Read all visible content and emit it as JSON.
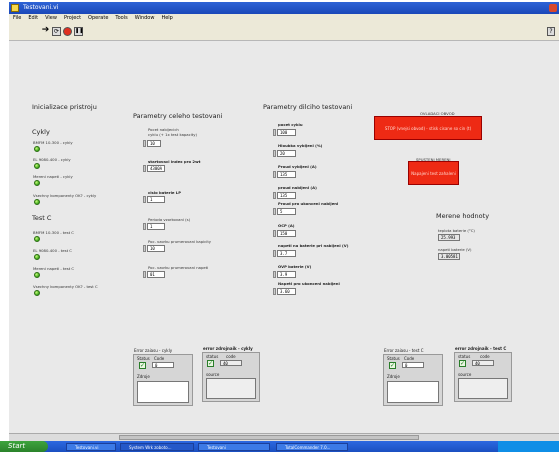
{
  "window": {
    "title": "Testovani.vi"
  },
  "menu": [
    "File",
    "Edit",
    "View",
    "Project",
    "Operate",
    "Tools",
    "Window",
    "Help"
  ],
  "init": {
    "heading": "Inicializace pristroju",
    "cycles_heading": "Cykly",
    "cycle_items": [
      "BMFM 10-300 - cykly",
      "EL 9080-400 - cykly",
      "Mereni napeti - cykly",
      "Vsechny komponenty OK? - cykly"
    ],
    "test_heading": "Test C",
    "test_items": [
      "BMFM 10-300 - test C",
      "EL 9080-400 - test C",
      "Mereni napeti - test C",
      "Vsechny komponenty OK? - test C"
    ]
  },
  "global": {
    "heading": "Parametry celeho testovani",
    "fields": [
      {
        "label": "Pocet nabijecich\ncyklu (+ 1x test kapacity)",
        "value": "10"
      },
      {
        "label": "startovaci index pro 2wt",
        "value": "4300A"
      },
      {
        "label": "cislo baterie LP",
        "value": "1"
      },
      {
        "label": "Perioda vzorkovani (s)",
        "value": "1"
      },
      {
        "label": "Poc. vzorku prumerovani kapicity",
        "value": "10"
      },
      {
        "label": "Poc. vzorku prumerovani napeti",
        "value": "01"
      }
    ]
  },
  "partial": {
    "heading": "Parametry dilciho testovani",
    "fields": [
      {
        "label": "pocet cyklu",
        "value": "100"
      },
      {
        "label": "Hloubka vybijeni  (%)",
        "value": "20"
      },
      {
        "label": "Proud vybijeni (A)",
        "value": "135"
      },
      {
        "label": "proud nabijeni (A)",
        "value": "135"
      },
      {
        "label": "Proud pro ukonceni nabijeni",
        "value": "5"
      },
      {
        "label": "OCP (A)",
        "value": "150"
      },
      {
        "label": "napeti na baterie pri nabijeni (V)",
        "value": "3.7"
      },
      {
        "label": "OVP baterie (V)",
        "value": "3.9"
      },
      {
        "label": "Napeti pro ukonceni nabijeni",
        "value": "3.60"
      }
    ]
  },
  "control": {
    "ovladaci_label": "OVLADACI OBVOD",
    "stop_text": "STOP (vnejsi obvod) - stisk cisane so cin (t)",
    "spusteni_label": "SPUSTENI MERENI",
    "start_text": "Napajeni test zahaleni"
  },
  "measured": {
    "heading": "Merene hodnoty",
    "temp_label": "teplota baterie (°C)",
    "temp_value": "25.993",
    "volt_label": "napeti baterie (V)",
    "volt_value": "3.00581"
  },
  "clusters": {
    "left_err_in": {
      "title": "Error zaiasu - cykly",
      "status": "Status",
      "code": "Code",
      "code_val": "0",
      "source": "Zdroje"
    },
    "left_err_out": {
      "title": "error zdrojnaik - cykly",
      "status": "status",
      "code": "code",
      "code_val": "40",
      "source": "source"
    },
    "right_err_in": {
      "title": "Error zaiasu - test C",
      "status": "Status",
      "code": "Code",
      "code_val": "0",
      "source": "Zdroje"
    },
    "right_err_out": {
      "title": "error zdrojnaik - test C",
      "status": "status",
      "code": "code",
      "code_val": "40",
      "source": "source"
    }
  },
  "taskbar": {
    "start": "Start",
    "tasks": [
      "Testovani.vi",
      "System Wrk zoboto...",
      "Testovani",
      "TotalCommander 7.0..."
    ]
  }
}
